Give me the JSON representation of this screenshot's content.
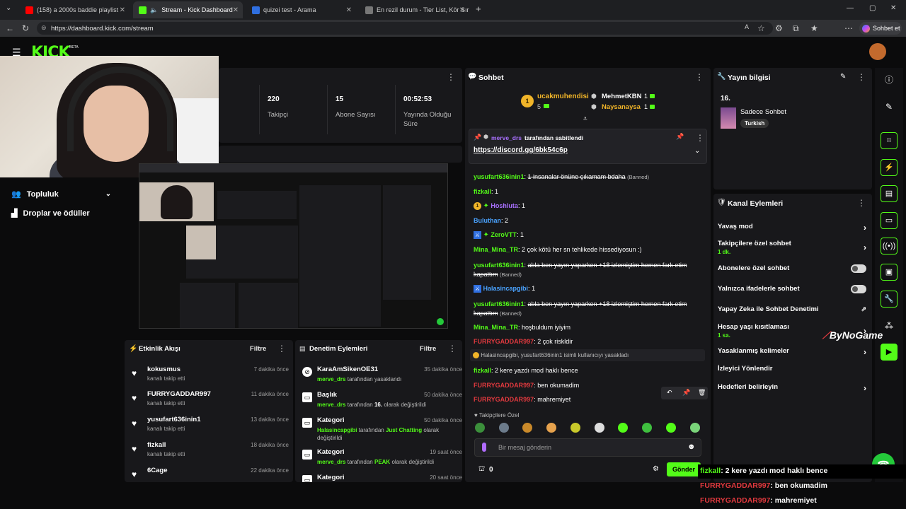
{
  "browser": {
    "tabs": [
      {
        "label": "(158) a 2000s baddie playlist",
        "favicon": "youtube-icon"
      },
      {
        "label": "Stream - Kick Dashboard",
        "favicon": "kick-icon"
      },
      {
        "label": "quizei test - Arama",
        "favicon": "search-icon"
      },
      {
        "label": "En rezil durum - Tier List, Kör Sıral",
        "favicon": "page-icon"
      }
    ],
    "url": "https://dashboard.kick.com/stream",
    "profile_label": "Sohbet et"
  },
  "header": {
    "logo": "KICK",
    "beta": "BETA"
  },
  "stats": [
    {
      "value": "220",
      "label": "Takipçi"
    },
    {
      "value": "15",
      "label": "Abone Sayısı"
    },
    {
      "value": "00:52:53",
      "label": "Yayında Olduğu Süre"
    }
  ],
  "sidebar": {
    "items": [
      {
        "label": "Topluluk"
      },
      {
        "label": "Droplar ve ödüller"
      }
    ]
  },
  "activity": {
    "title": "Etkinlik Akışı",
    "filter": "Filtre",
    "items": [
      {
        "name": "kokusmus",
        "desc": "kanalı takip etti",
        "time": "7 dakika önce"
      },
      {
        "name": "FURRYGADDAR997",
        "desc": "kanalı takip etti",
        "time": "11 dakika önce"
      },
      {
        "name": "yusufart636inin1",
        "desc": "kanalı takip etti",
        "time": "13 dakika önce"
      },
      {
        "name": "fizkall",
        "desc": "kanalı takip etti",
        "time": "18 dakika önce"
      },
      {
        "name": "6Cage",
        "desc": "",
        "time": "22 dakika önce"
      }
    ]
  },
  "moderation": {
    "title": "Denetim Eylemleri",
    "filter": "Filtre",
    "items": [
      {
        "name": "KaraAmSikenOE31",
        "actor": "merve_drs",
        "desc": "tarafından yasaklandı",
        "time": "35 dakika önce"
      },
      {
        "name": "Başlık",
        "actor": "merve_drs",
        "desc": "tarafından",
        "extra": "16.",
        "desc2": "olarak değiştirildi",
        "time": "50 dakika önce"
      },
      {
        "name": "Kategori",
        "actor": "Halasincapgibi",
        "desc": "tarafından",
        "extra": "Just Chatting",
        "desc2": "olarak değiştirildi",
        "time": "50 dakika önce"
      },
      {
        "name": "Kategori",
        "actor": "merve_drs",
        "desc": "tarafından",
        "extra": "PEAK",
        "desc2": "olarak değiştirildi",
        "time": "19 saat önce"
      },
      {
        "name": "Kategori",
        "time": "20 saat önce"
      }
    ]
  },
  "chat": {
    "title": "Sohbet",
    "top_gifters": [
      {
        "rank": "1",
        "name": "ucakmuhendisi",
        "count": "5"
      },
      {
        "name": "MehmetKBN",
        "count": "1"
      },
      {
        "name": "Naysanaysa",
        "count": "1"
      }
    ],
    "pinned": {
      "by": "merve_drs",
      "suffix": "tarafından sabitlendi",
      "link": "https://discord.gg/6bk54c6p"
    },
    "messages": [
      {
        "user": "yusufart636inin1",
        "color": "#53fc18",
        "text": "1 insanalar önüne çıkamam bdaha",
        "banned": "(Banned)",
        "strike": true
      },
      {
        "user": "fizkall",
        "color": "#53fc18",
        "text": "1"
      },
      {
        "user": "Hoshluta",
        "color": "#a970ff",
        "text": "1"
      },
      {
        "user": "Buluthan",
        "color": "#4aa3ff",
        "text": "2"
      },
      {
        "user": "ZeroVTT",
        "color": "#53fc18",
        "text": "1"
      },
      {
        "user": "Mina_Mina_TR",
        "color": "#53fc18",
        "text": "2 çok kötü her sn tehlikede hissediyosun :)"
      },
      {
        "user": "yusufart636inin1",
        "color": "#53fc18",
        "text": "abla ben yayın yaparken +18 izlemiştim hemen fark etim kapattım",
        "banned": "(Banned)",
        "strike": true
      },
      {
        "user": "Halasincapgibi",
        "color": "#4aa3ff",
        "text": "1"
      },
      {
        "user": "yusufart636inin1",
        "color": "#53fc18",
        "text": "abla ben yayın yaparken +18 izlemiştim hemen fark etim kapattım",
        "banned": "(Banned)",
        "strike": true
      },
      {
        "user": "Mina_Mina_TR",
        "color": "#53fc18",
        "text": "hoşbuldum iyiyim"
      },
      {
        "user": "FURRYGADDAR997",
        "color": "#e0393e",
        "text": "2 çok riskldir"
      },
      {
        "system": "Halasincapgibi, yusufart636inin1 isimli kullanıcıyı yasakladı"
      },
      {
        "user": "fizkall",
        "color": "#53fc18",
        "text": "2 kere yazdı mod haklı bence"
      },
      {
        "user": "FURRYGADDAR997",
        "color": "#e0393e",
        "text": "ben okumadim"
      },
      {
        "user": "FURRYGADDAR997",
        "color": "#e0393e",
        "text": "mahremiyet"
      }
    ],
    "followers_only": "Takipçilere Özel",
    "input_placeholder": "Bir mesaj gönderin",
    "points": "0",
    "send": "Gönder"
  },
  "stream_info": {
    "title": "Yayın bilgisi",
    "stream_title": "16.",
    "category": "Sadece Sohbet",
    "tag": "Turkish"
  },
  "channel_actions": {
    "title": "Kanal Eylemleri",
    "items": [
      {
        "label": "Yavaş mod",
        "control": "chevron"
      },
      {
        "label": "Takipçilere özel sohbet",
        "sub": "1 dk.",
        "control": "chevron"
      },
      {
        "label": "Abonelere özel sohbet",
        "control": "toggle"
      },
      {
        "label": "Yalnızca ifadelerle sohbet",
        "control": "toggle"
      },
      {
        "label": "Yapay Zeka ile Sohbet Denetimi",
        "control": "external"
      },
      {
        "label": "Hesap yaşı kısıtlaması",
        "sub": "1 sa.",
        "control": "chevron"
      },
      {
        "label": "Yasaklanmış kelimeler",
        "control": "chevron"
      },
      {
        "label": "İzleyici Yönlendir",
        "control": "none"
      },
      {
        "label": "Hedefleri belirleyin",
        "control": "chevron"
      }
    ]
  },
  "watermark": "ByNoGame",
  "overlay": [
    {
      "user": "fizkall",
      "color": "#53fc18",
      "text": ": 2 kere yazdı mod haklı bence"
    },
    {
      "user": "FURRYGADDAR997",
      "color": "#e0393e",
      "text": ": ben okumadim"
    },
    {
      "user": "FURRYGADDAR997",
      "color": "#e0393e",
      "text": ": mahremiyet"
    }
  ]
}
